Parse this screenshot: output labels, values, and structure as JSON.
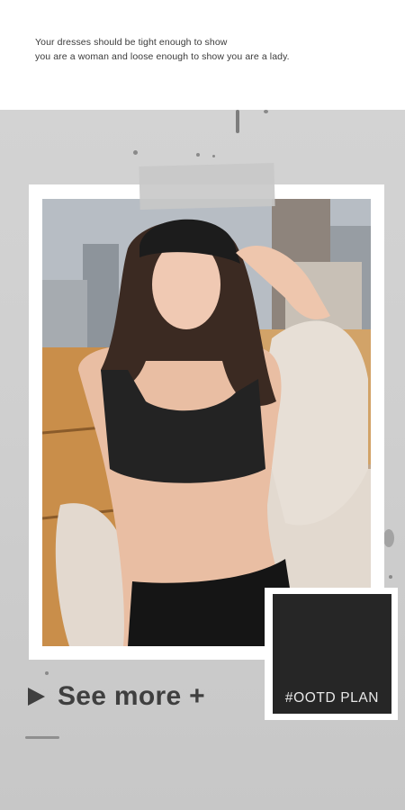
{
  "quote": {
    "line1": "Your dresses should be tight enough to show",
    "line2": "you are a woman and loose enough to show you are a lady."
  },
  "photo": {
    "description_icon": "fashion-model-photo"
  },
  "cta": {
    "label": "See more +",
    "icon": "play-icon"
  },
  "tag": {
    "label": "#OOTD PLAN"
  },
  "colors": {
    "backdrop": "#cfcfcf",
    "dark_box": "#262626",
    "text_dark": "#3f3f3f"
  }
}
